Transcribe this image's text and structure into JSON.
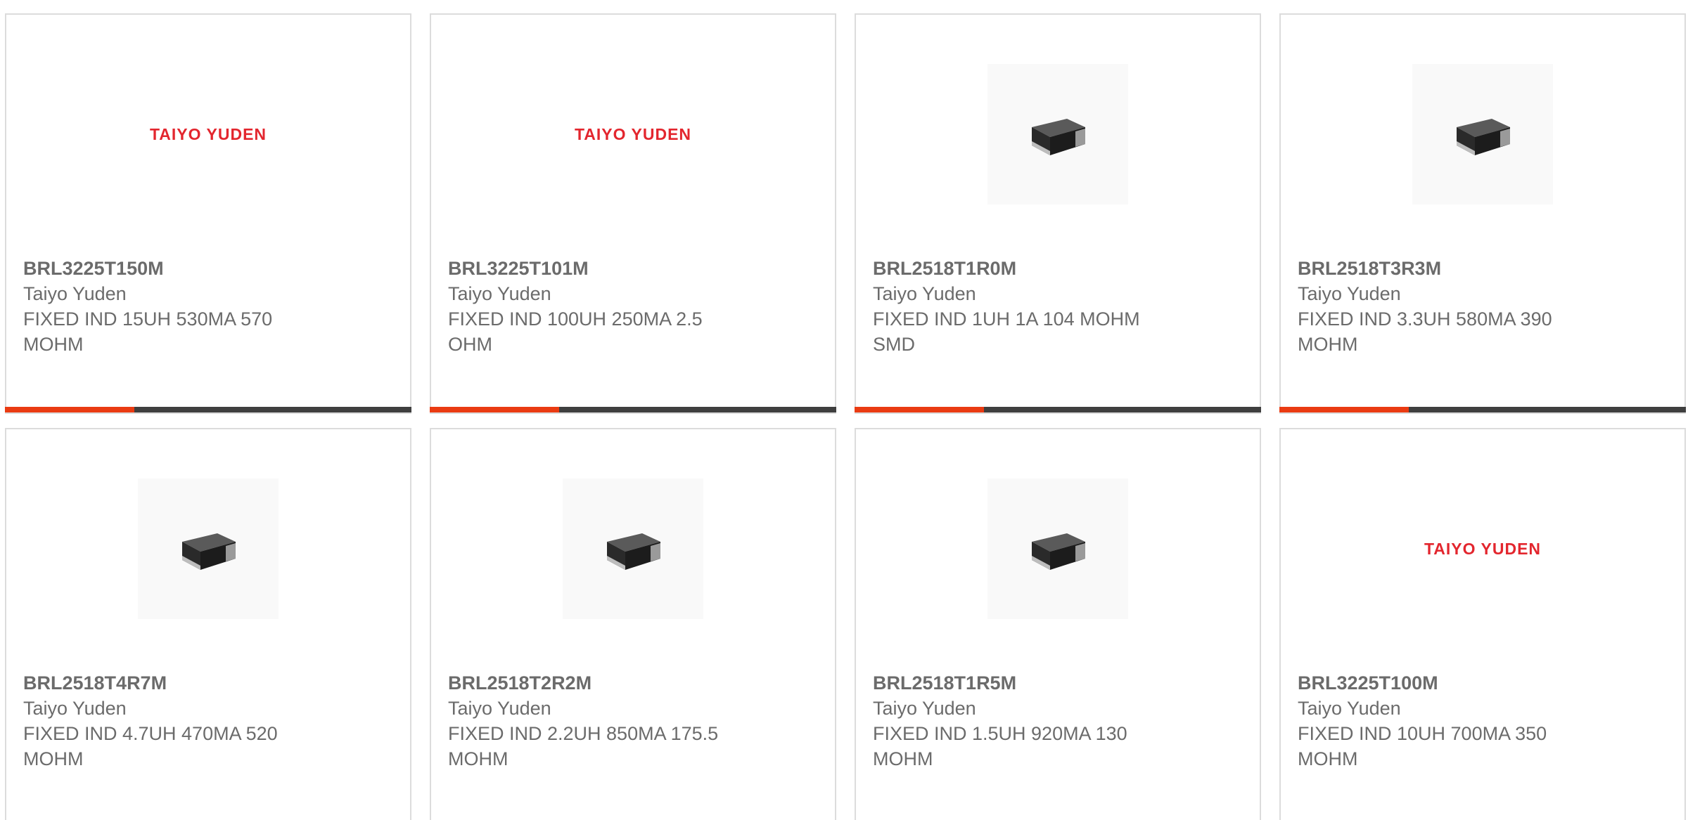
{
  "colors": {
    "brand_logo": "#e3262e",
    "accent_bar": "#ea3b12",
    "bar": "#3f3f3f",
    "text": "#6b6b6b",
    "border": "#dcdcdc"
  },
  "products": [
    {
      "part": "BRL3225T150M",
      "maker": "Taiyo Yuden",
      "desc_line1": "FIXED IND 15UH 530MA 570",
      "desc_line2": "MOHM",
      "image": "logo",
      "logo_text": "TAIYO YUDEN"
    },
    {
      "part": "BRL3225T101M",
      "maker": "Taiyo Yuden",
      "desc_line1": "FIXED IND 100UH 250MA 2.5",
      "desc_line2": "OHM",
      "image": "logo",
      "logo_text": "TAIYO YUDEN"
    },
    {
      "part": "BRL2518T1R0M",
      "maker": "Taiyo Yuden",
      "desc_line1": "FIXED IND 1UH 1A 104 MOHM",
      "desc_line2": "SMD",
      "image": "chip-inductor-icon"
    },
    {
      "part": "BRL2518T3R3M",
      "maker": "Taiyo Yuden",
      "desc_line1": "FIXED IND 3.3UH 580MA 390",
      "desc_line2": "MOHM",
      "image": "chip-inductor-icon"
    },
    {
      "part": "BRL2518T4R7M",
      "maker": "Taiyo Yuden",
      "desc_line1": "FIXED IND 4.7UH 470MA 520",
      "desc_line2": "MOHM",
      "image": "chip-inductor-icon"
    },
    {
      "part": "BRL2518T2R2M",
      "maker": "Taiyo Yuden",
      "desc_line1": "FIXED IND 2.2UH 850MA 175.5",
      "desc_line2": "MOHM",
      "image": "chip-inductor-icon"
    },
    {
      "part": "BRL2518T1R5M",
      "maker": "Taiyo Yuden",
      "desc_line1": "FIXED IND 1.5UH 920MA 130",
      "desc_line2": "MOHM",
      "image": "chip-inductor-icon"
    },
    {
      "part": "BRL3225T100M",
      "maker": "Taiyo Yuden",
      "desc_line1": "FIXED IND 10UH 700MA 350",
      "desc_line2": "MOHM",
      "image": "logo",
      "logo_text": "TAIYO YUDEN"
    }
  ]
}
